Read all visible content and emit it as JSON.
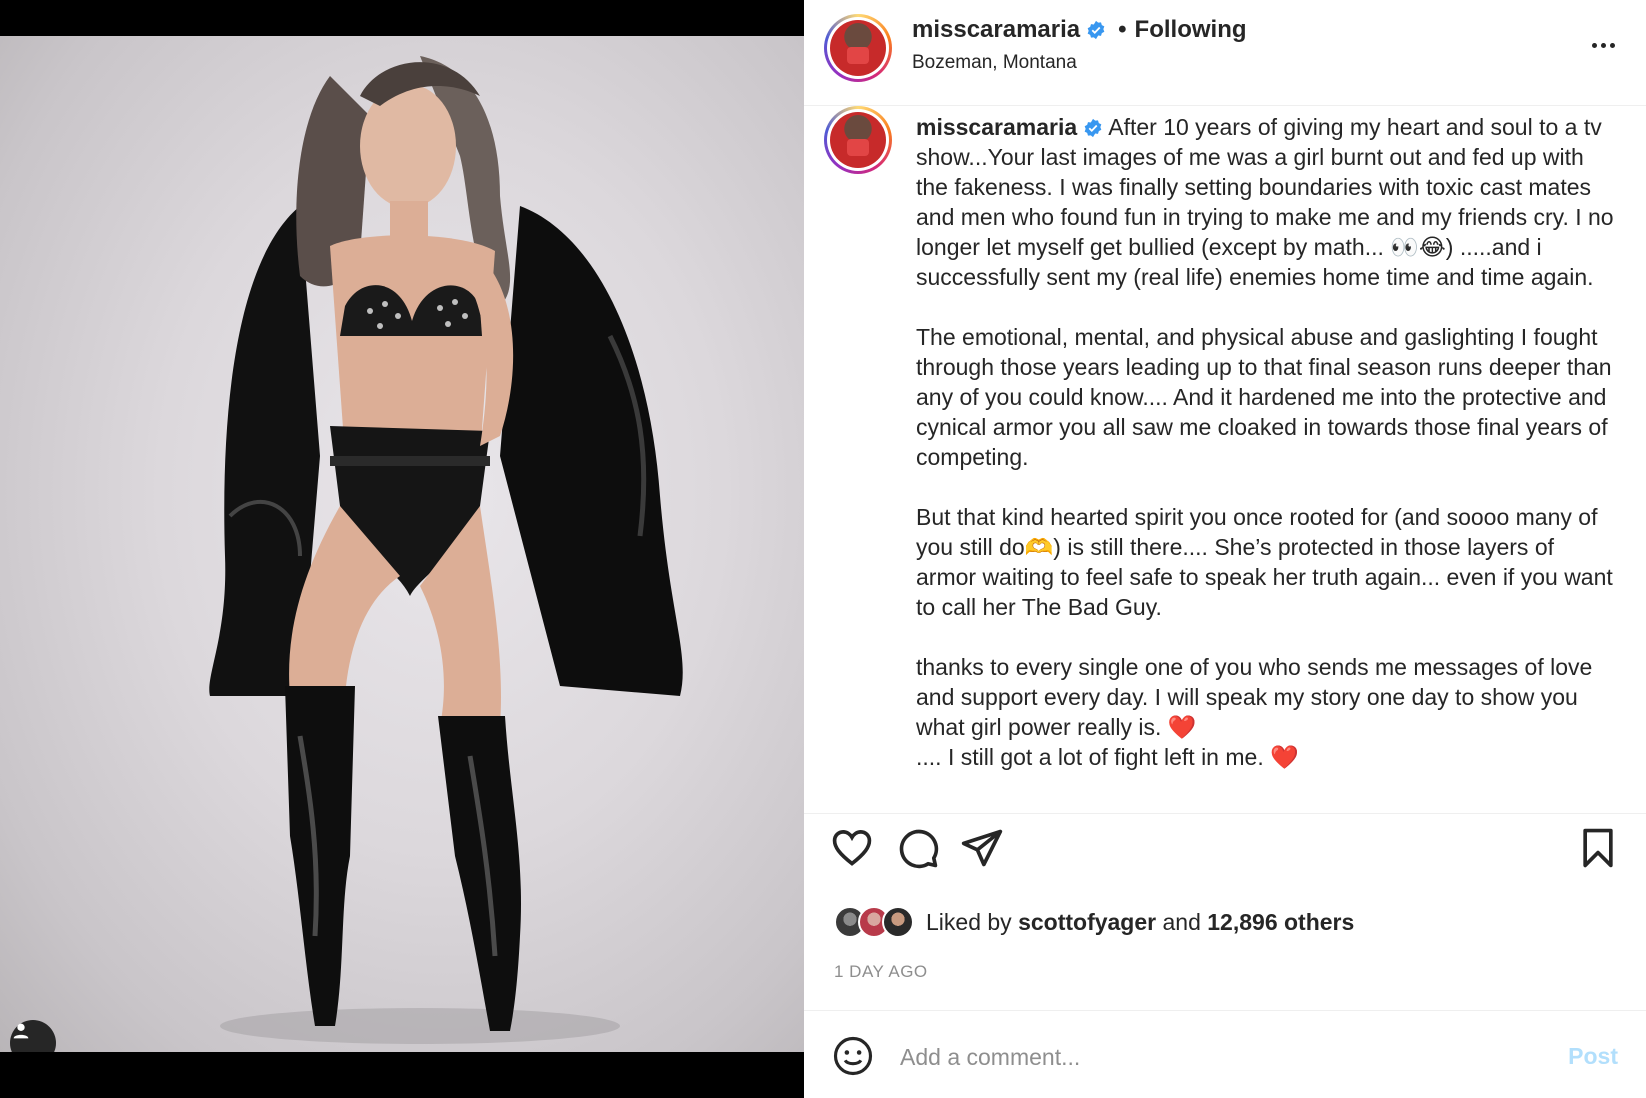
{
  "header": {
    "username": "misscaramaria",
    "separator": "•",
    "follow_status": "Following",
    "location": "Bozeman, Montana"
  },
  "caption": {
    "username": "misscaramaria",
    "paragraphs": [
      "After 10 years of giving my heart and soul to a tv show...Your last images of me was a girl burnt out and fed up with the fakeness. I was finally setting boundaries with toxic cast mates and men who found fun in trying to make me and my friends cry. I no longer let myself get bullied (except by math... 👀😂) .....and i successfully sent my (real life) enemies home time and time again.",
      "The emotional, mental, and physical abuse and gaslighting I fought through those years leading up to that final season runs deeper than any of you could know.... And it hardened me into the protective and cynical armor you all saw me cloaked in towards those final years of competing.",
      "But that kind hearted spirit you once rooted for (and soooo many of you still do🫶) is still there.... She’s protected in those layers of armor waiting to feel safe to speak her truth again... even if you want to call her The Bad Guy.",
      "thanks to every single one of you who sends me messages of love and support every day. I will speak my story one day to show you what girl power really is. ❤️\n.... I still got a lot of fight left in me. ❤️"
    ]
  },
  "icons": {
    "like": "heart-icon",
    "comment": "comment-icon",
    "share": "send-icon",
    "save": "bookmark-icon",
    "emoji": "smiley-icon",
    "more": "more-dots-icon",
    "user_tag": "user-icon",
    "verified": "verified-badge-icon"
  },
  "likes": {
    "prefix": "Liked by",
    "first_user": "scottofyager",
    "connector": "and",
    "others": "12,896 others"
  },
  "timestamp": "1 DAY AGO",
  "comment": {
    "placeholder": "Add a comment...",
    "post_label": "Post"
  },
  "colors": {
    "verified": "#3897f0",
    "post_disabled": "#b2dffc",
    "muted": "#8e8e8e",
    "text": "#262626"
  }
}
